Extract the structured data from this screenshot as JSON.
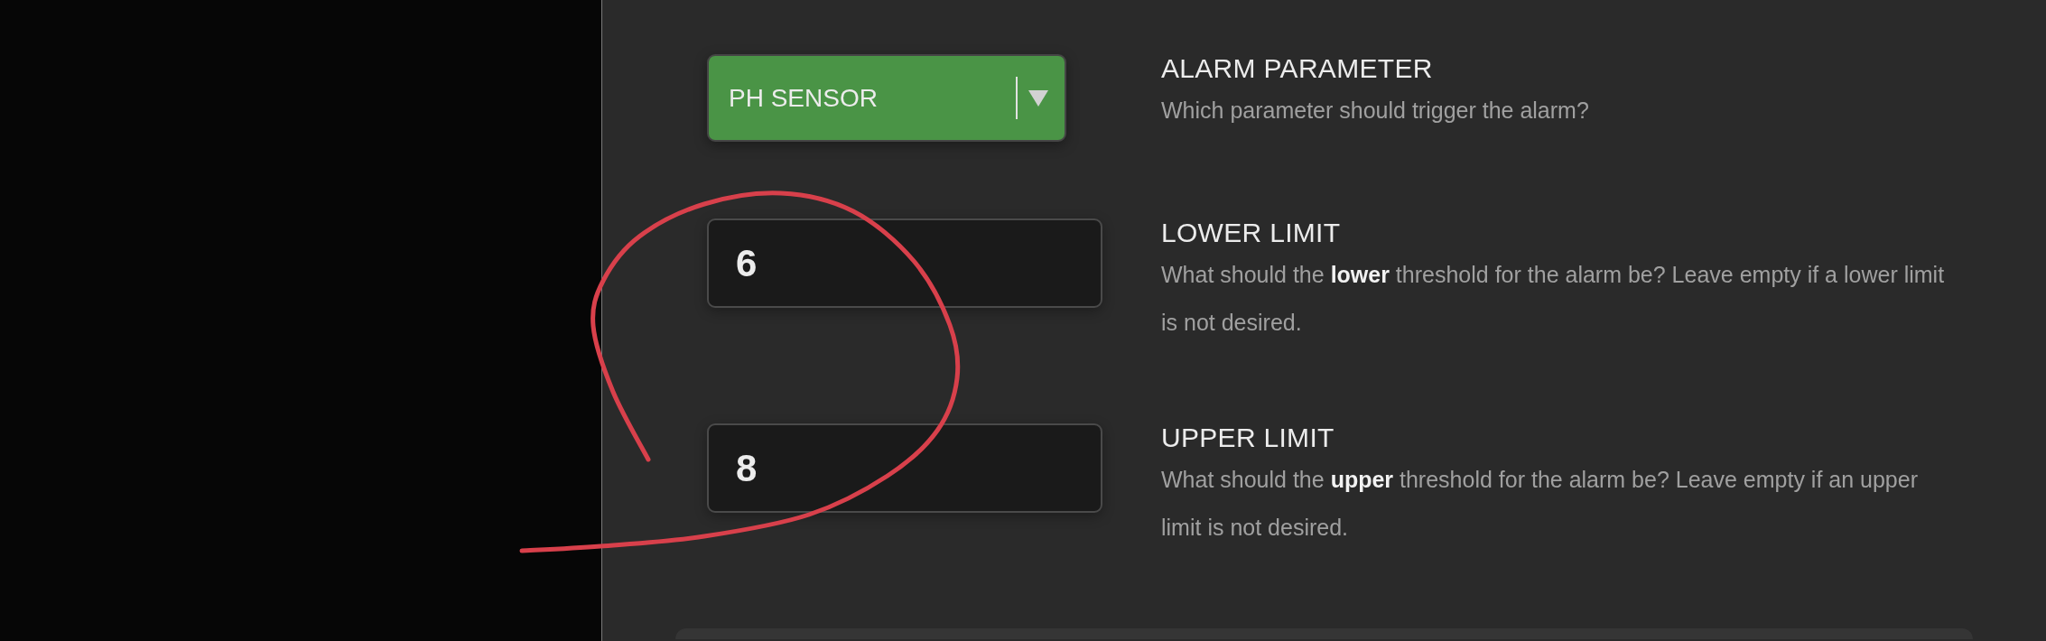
{
  "fields": [
    {
      "kind": "dropdown",
      "value": "PH SENSOR",
      "label": "ALARM PARAMETER",
      "description": "Which parameter should trigger the alarm?"
    },
    {
      "kind": "number",
      "value": "6",
      "label": "LOWER LIMIT",
      "description": "What should the **lower** threshold for the alarm be? Leave empty if a lower limit is not desired."
    },
    {
      "kind": "number",
      "value": "8",
      "label": "UPPER LIMIT",
      "description": "What should the **upper** threshold for the alarm be? Leave empty if an upper limit is not desired."
    }
  ]
}
